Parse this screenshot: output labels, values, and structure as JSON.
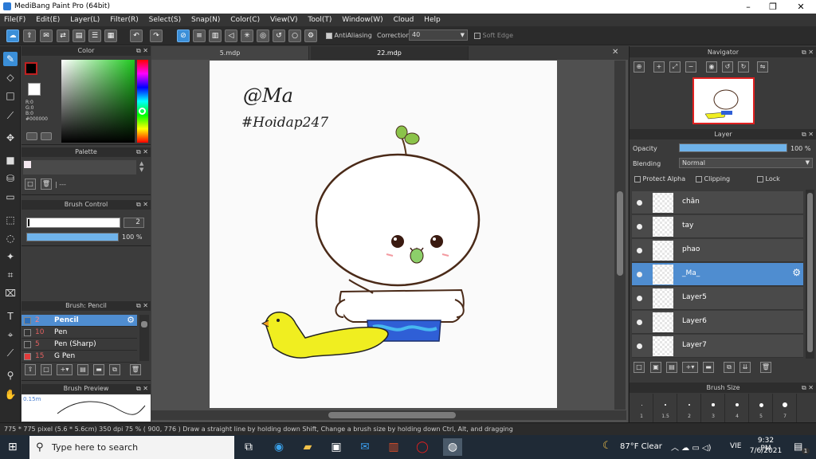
{
  "window": {
    "title": "MediBang Paint Pro (64bit)",
    "minimize_label": "–",
    "maximize_label": "❐",
    "close_label": "✕"
  },
  "menu": [
    "File(F)",
    "Edit(E)",
    "Layer(L)",
    "Filter(R)",
    "Select(S)",
    "Snap(N)",
    "Color(C)",
    "View(V)",
    "Tool(T)",
    "Window(W)",
    "Cloud",
    "Help"
  ],
  "toolbar": {
    "antialiasing_label": "AntiAliasing",
    "antialiasing_checked": true,
    "correction_label": "Correction",
    "correction_value": "40",
    "soft_edge_label": "Soft Edge",
    "soft_edge_checked": false
  },
  "color_panel": {
    "title": "Color",
    "r": "R:0",
    "g": "G:0",
    "b": "B:0",
    "hex": "#000000",
    "fg_color": "#000000",
    "bg_color": "#ffffff"
  },
  "palette_panel": {
    "title": "Palette",
    "footer_text": "| ---"
  },
  "brush_control": {
    "title": "Brush Control",
    "size": "2",
    "opacity_label": "100 %",
    "opacity_fraction": 1.0
  },
  "brush_list": {
    "title": "Brush: Pencil",
    "items": [
      {
        "size": "2",
        "name": "Pencil",
        "selected": true,
        "swatch": "#2f6fb8"
      },
      {
        "size": "10",
        "name": "Pen",
        "selected": false,
        "swatch": "#333333"
      },
      {
        "size": "5",
        "name": "Pen (Sharp)",
        "selected": false,
        "swatch": "#333333"
      },
      {
        "size": "15",
        "name": "G Pen",
        "selected": false,
        "swatch": "#e23b3b"
      }
    ]
  },
  "brush_preview": {
    "title": "Brush Preview",
    "size_label": "0.15m"
  },
  "tabs": [
    {
      "label": "5.mdp",
      "active": false
    },
    {
      "label": "22.mdp",
      "active": true
    }
  ],
  "canvas_text": {
    "handle": "@Ma",
    "hashtag": "#Hoidap247"
  },
  "navigator": {
    "title": "Navigator"
  },
  "layer_panel": {
    "title": "Layer",
    "opacity_label": "Opacity",
    "opacity_value": "100 %",
    "opacity_fraction": 1.0,
    "blending_label": "Blending",
    "blending_value": "Normal",
    "protect_alpha_label": "Protect Alpha",
    "clipping_label": "Clipping",
    "lock_label": "Lock",
    "layers": [
      {
        "name": "chân",
        "selected": false
      },
      {
        "name": "tay",
        "selected": false
      },
      {
        "name": "phao",
        "selected": false
      },
      {
        "name": "_Ma_",
        "selected": true
      },
      {
        "name": "Layer5",
        "selected": false
      },
      {
        "name": "Layer6",
        "selected": false
      },
      {
        "name": "Layer7",
        "selected": false
      }
    ]
  },
  "brush_size_panel": {
    "title": "Brush Size",
    "sizes": [
      "1",
      "1.5",
      "2",
      "3",
      "4",
      "5",
      "7"
    ]
  },
  "status": {
    "text": "775 * 775 pixel   (5.6 * 5.6cm)   350 dpi   75 %   ( 900, 776 )   Draw a straight line by holding down Shift, Change a brush size by holding down Ctrl, Alt, and dragging"
  },
  "taskbar": {
    "search_placeholder": "Type here to search",
    "weather": "87°F  Clear",
    "language": "VIE",
    "time": "9:32 PM",
    "date": "7/6/2021",
    "notification_count": "1"
  }
}
